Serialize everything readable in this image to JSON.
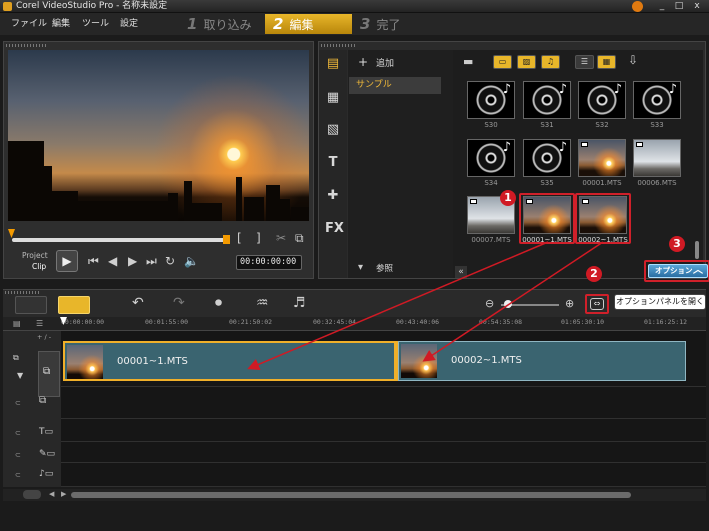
{
  "window": {
    "title": "Corel VideoStudio Pro - 名称未設定",
    "controls": [
      "_",
      "□",
      "x"
    ]
  },
  "menu": [
    "ファイル",
    "編集",
    "ツール",
    "設定"
  ],
  "steps": [
    {
      "num": "1",
      "label": "取り込み",
      "active": false
    },
    {
      "num": "2",
      "label": "編集",
      "active": true
    },
    {
      "num": "3",
      "label": "完了",
      "active": false
    }
  ],
  "preview": {
    "mode_project": "Project",
    "mode_clip": "Clip",
    "timecode": "00:00:00:00"
  },
  "library": {
    "add_label": "追加",
    "folder_item": "サンプル",
    "browse_label": "参照",
    "thumbnails": [
      {
        "label": "S30",
        "kind": "audio"
      },
      {
        "label": "S31",
        "kind": "audio"
      },
      {
        "label": "S32",
        "kind": "audio"
      },
      {
        "label": "S33",
        "kind": "audio"
      },
      {
        "label": "S34",
        "kind": "audio"
      },
      {
        "label": "S35",
        "kind": "audio"
      },
      {
        "label": "00001.MTS",
        "kind": "sunset"
      },
      {
        "label": "00006.MTS",
        "kind": "sky"
      },
      {
        "label": "00007.MTS",
        "kind": "sky"
      },
      {
        "label": "00001~1.MTS",
        "kind": "sunset"
      },
      {
        "label": "00002~1.MTS",
        "kind": "sunset"
      }
    ]
  },
  "option_button": "オプション",
  "option_tooltip": "オプションパネルを開く",
  "callouts": [
    "1",
    "2",
    "3"
  ],
  "timeline": {
    "ruler": [
      "00:00:00:00",
      "00:01:55:00",
      "00:21:50:02",
      "00:32:45:04",
      "00:43:40:06",
      "00:54:35:08",
      "01:05:30:10",
      "01:16:25:12"
    ],
    "clips": [
      "00001~1.MTS",
      "00002~1.MTS"
    ],
    "track_add": "+ / -"
  }
}
